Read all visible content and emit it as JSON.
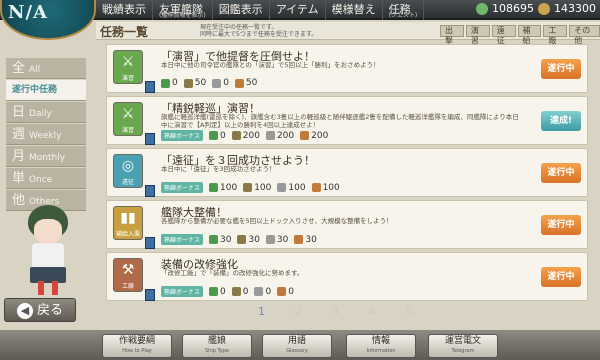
{
  "app": {
    "logo_text": "N/A"
  },
  "nav": [
    {
      "label": "戦績表示",
      "sub": ""
    },
    {
      "label": "友軍艦隊",
      "sub": "(艦隊情報を表示)"
    },
    {
      "label": "図鑑表示",
      "sub": ""
    },
    {
      "label": "アイテム",
      "sub": ""
    },
    {
      "label": "模様替え",
      "sub": ""
    },
    {
      "label": "任務",
      "sub": "(クエスト)"
    }
  ],
  "resources": {
    "res1": "108695",
    "res2": "143300"
  },
  "quest_header": {
    "title": "任務一覧",
    "note_line1": "現在受注中の任務一覧です。",
    "note_line2": "同時に最大で5つまで任務を受注できます。",
    "filters": [
      "出撃",
      "演習",
      "遠征",
      "補給",
      "工廠",
      "その他"
    ]
  },
  "categories": [
    {
      "kanji": "全",
      "label": "All",
      "active": false
    },
    {
      "kanji": "",
      "label": "遂行中任務",
      "active": true
    },
    {
      "kanji": "日",
      "label": "Daily",
      "active": false
    },
    {
      "kanji": "週",
      "label": "Weekly",
      "active": false
    },
    {
      "kanji": "月",
      "label": "Monthly",
      "active": false
    },
    {
      "kanji": "単",
      "label": "Once",
      "active": false
    },
    {
      "kanji": "他",
      "label": "Others",
      "active": false
    }
  ],
  "quests": [
    {
      "icon_label": "演習",
      "icon_color": "#6aa84f",
      "title": "「演習」で他提督を圧倒せよ！",
      "desc": "本日中に他の司令官の艦隊との「演習」で5回以上「勝利」をおさめよう！",
      "bonus": "",
      "r1": "0",
      "r2": "50",
      "r3": "0",
      "r4": "50",
      "status": "遂行中",
      "status_type": "progress"
    },
    {
      "icon_label": "演習",
      "icon_color": "#6aa84f",
      "title": "「精鋭軽巡」演習！",
      "desc": "旗艦に軽巡洋艦(雷巡を除く)、旗艦含む3隻以上の軽巡級と随伴駆逐艦2隻を配備した軽巡洋艦隊を編成、同艦隊により本日中に演習で【A判定】以上の勝利を4回以上達成せよ！",
      "bonus": "熟練ボーナス",
      "r1": "0",
      "r2": "200",
      "r3": "200",
      "r4": "200",
      "status": "達成!",
      "status_type": "done"
    },
    {
      "icon_label": "遠征",
      "icon_color": "#4a9fb1",
      "title": "「遠征」を３回成功させよう！",
      "desc": "本日中に「遠征」を3回成功させよう！",
      "bonus": "熟練ボーナス",
      "r1": "100",
      "r2": "100",
      "r3": "100",
      "r4": "100",
      "status": "遂行中",
      "status_type": "progress"
    },
    {
      "icon_label": "補給入渠",
      "icon_color": "#c8a040",
      "title": "艦隊大整備！",
      "desc": "各艦隊から整備が必要な艦を5回以上ドック入りさせ、大規模な整備をしよう！",
      "bonus": "熟練ボーナス",
      "r1": "30",
      "r2": "30",
      "r3": "30",
      "r4": "30",
      "status": "遂行中",
      "status_type": "progress"
    },
    {
      "icon_label": "工廠",
      "icon_color": "#b06a4a",
      "title": "装備の改修強化",
      "desc": "「改修工廠」で「装備」の改修強化に努めます。",
      "bonus": "熟練ボーナス",
      "r1": "0",
      "r2": "0",
      "r3": "0",
      "r4": "0",
      "status": "遂行中",
      "status_type": "progress"
    }
  ],
  "pages": [
    "1",
    "2",
    "3",
    "4",
    "5"
  ],
  "back_label": "戻る",
  "bottom_buttons": [
    {
      "label": "作戦要綱",
      "en": "How to Play"
    },
    {
      "label": "艦娘",
      "en": "Ship Type"
    },
    {
      "label": "用語",
      "en": "Glossary"
    },
    {
      "label": "情報",
      "en": "Information"
    },
    {
      "label": "運営電文",
      "en": "Telegram"
    }
  ]
}
